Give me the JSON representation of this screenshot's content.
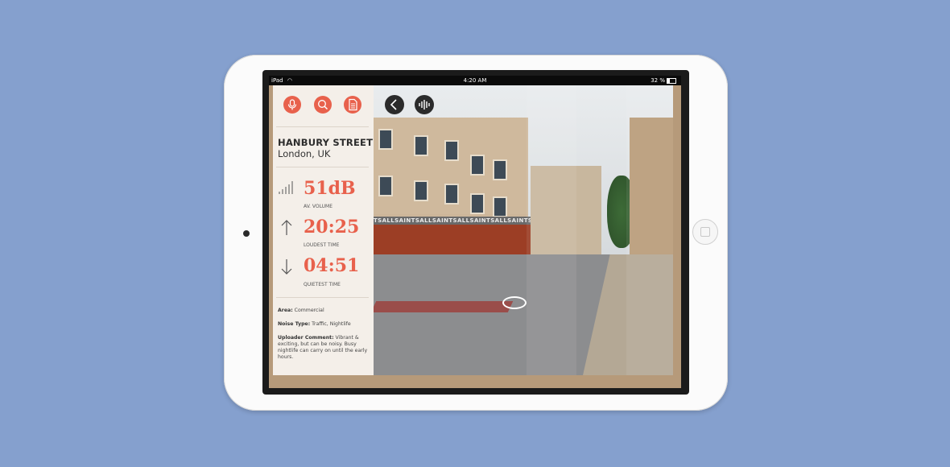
{
  "device": {
    "status_bar": {
      "carrier": "iPad",
      "time": "4:20 AM",
      "battery": "32 %"
    }
  },
  "panel": {
    "toolbar": {
      "buttons": [
        {
          "icon": "microphone-icon"
        },
        {
          "icon": "search-icon"
        },
        {
          "icon": "document-icon"
        }
      ],
      "accent_color": "#e8614c"
    },
    "location": {
      "street": "HANBURY STREET",
      "city": "London, UK"
    },
    "stats": [
      {
        "icon": "volume-bars-icon",
        "value": "51dB",
        "label": "AV. VOLUME"
      },
      {
        "icon": "arrow-up-icon",
        "value": "20:25",
        "label": "LOUDEST TIME"
      },
      {
        "icon": "arrow-down-icon",
        "value": "04:51",
        "label": "QUIETEST TIME"
      }
    ],
    "details": {
      "area_label": "Area:",
      "area_value": "Commercial",
      "noise_label": "Noise Type:",
      "noise_value": "Traffic, Nightlife",
      "comment_label": "Uploader Comment:",
      "comment_value": "Vibrant & exciting, but can be noisy. Busy nightlife can carry on until the early hours."
    }
  },
  "photo": {
    "controls": [
      {
        "icon": "back-chevron-icon"
      },
      {
        "icon": "soundwave-icon"
      }
    ],
    "shop_sign": "TSALLSAINTSALLSAINTSALLSAINTSALLSAINTS"
  }
}
